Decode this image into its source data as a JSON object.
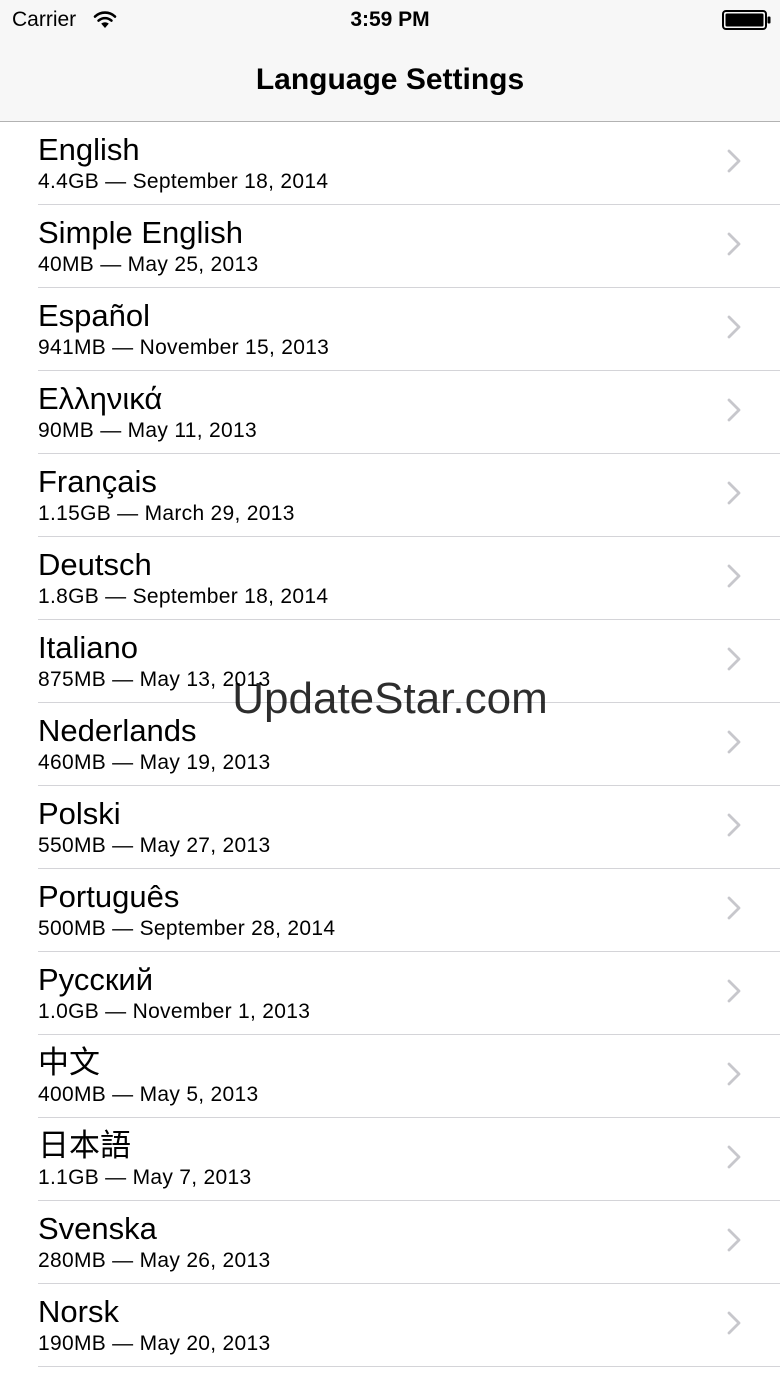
{
  "status_bar": {
    "carrier": "Carrier",
    "time": "3:59 PM",
    "wifi_icon": "wifi-icon",
    "battery_icon": "battery-icon"
  },
  "nav": {
    "title": "Language Settings"
  },
  "languages": [
    {
      "name": "English",
      "detail": "4.4GB — September 18, 2014"
    },
    {
      "name": "Simple English",
      "detail": "40MB — May 25, 2013"
    },
    {
      "name": "Español",
      "detail": "941MB — November 15, 2013"
    },
    {
      "name": "Ελληνικά",
      "detail": "90MB — May 11, 2013"
    },
    {
      "name": "Français",
      "detail": "1.15GB — March 29, 2013"
    },
    {
      "name": "Deutsch",
      "detail": "1.8GB — September 18, 2014"
    },
    {
      "name": "Italiano",
      "detail": "875MB — May 13, 2013"
    },
    {
      "name": "Nederlands",
      "detail": "460MB — May 19, 2013"
    },
    {
      "name": "Polski",
      "detail": "550MB — May 27, 2013"
    },
    {
      "name": "Português",
      "detail": "500MB — September 28, 2014"
    },
    {
      "name": "Русский",
      "detail": "1.0GB — November 1, 2013"
    },
    {
      "name": "中文",
      "detail": "400MB — May 5, 2013"
    },
    {
      "name": "日本語",
      "detail": "1.1GB — May 7, 2013"
    },
    {
      "name": "Svenska",
      "detail": "280MB — May 26, 2013"
    },
    {
      "name": "Norsk",
      "detail": "190MB — May 20, 2013"
    }
  ],
  "row_icon": "chevron-right-icon",
  "watermark": "UpdateStar.com",
  "colors": {
    "bar_background": "#f7f7f7",
    "separator": "#d4d4d8",
    "chevron": "#c7c7cc"
  }
}
